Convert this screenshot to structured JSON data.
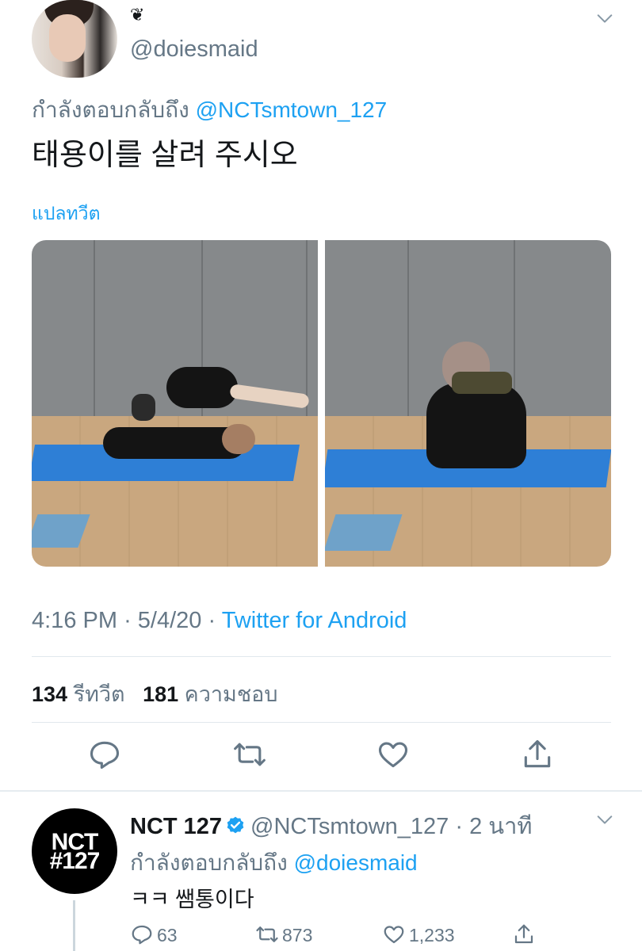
{
  "tweet": {
    "display_name": "❦",
    "handle": "@doiesmaid",
    "replying_prefix": "กำลังตอบกลับถึง",
    "replying_to": "@NCTsmtown_127",
    "text": "태용이를 살려 주시오",
    "translate_label": "แปลทวีต",
    "time": "4:16 PM",
    "date": "5/4/20",
    "separator": "·",
    "source": "Twitter for Android",
    "retweet_count": "134",
    "retweet_label": "รีทวีต",
    "like_count": "181",
    "like_label": "ความชอบ"
  },
  "reply": {
    "name": "NCT 127",
    "handle": "@NCTsmtown_127",
    "time_ago": "2 นาที",
    "separator": "·",
    "replying_prefix": "กำลังตอบกลับถึง",
    "replying_to": "@doiesmaid",
    "text": "ㅋㅋ 쌤통이다",
    "avatar_line1": "NCT",
    "avatar_line2": "#127",
    "reply_count": "63",
    "retweet_count": "873",
    "like_count": "1,233"
  },
  "colors": {
    "link_blue": "#1da1f2",
    "secondary_gray": "#657786",
    "text_dark": "#14171a",
    "divider": "#e1e8ed"
  },
  "icons": {
    "reply": "reply-icon",
    "retweet": "retweet-icon",
    "like": "heart-icon",
    "share": "share-icon",
    "menu": "chevron-down-icon",
    "verified": "verified-badge-icon"
  }
}
